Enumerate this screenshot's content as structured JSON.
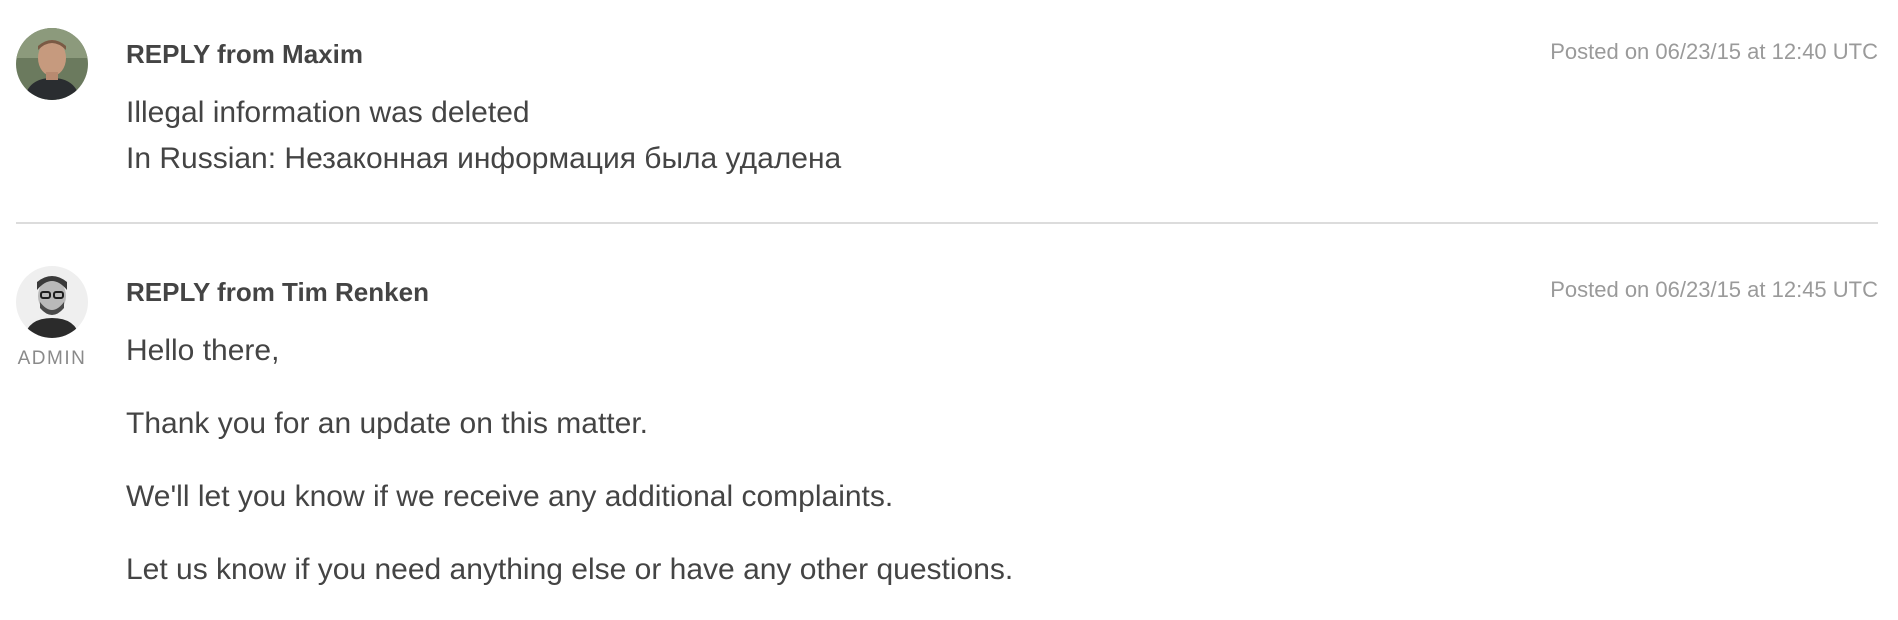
{
  "replies": [
    {
      "author_line": "REPLY from Maxim",
      "timestamp": "Posted on 06/23/15 at 12:40 UTC",
      "avatar_icon": "user-photo-maxim",
      "lines": [
        "Illegal information was deleted",
        "In Russian: Незаконная информация была удалена"
      ]
    },
    {
      "author_line": "REPLY from Tim Renken",
      "timestamp": "Posted on 06/23/15 at 12:45 UTC",
      "avatar_icon": "user-photo-tim-renken",
      "role": "ADMIN",
      "lines": [
        "Hello there,",
        "Thank you for an update on this matter.",
        "We'll let you know if we receive any additional complaints.",
        "Let us know if you need anything else or have any other questions."
      ]
    }
  ],
  "colors": {
    "text": "#444444",
    "muted": "#9a9a9a",
    "divider": "#dcdcdc"
  }
}
